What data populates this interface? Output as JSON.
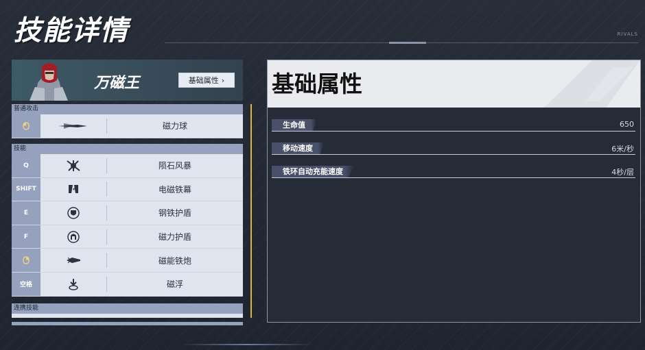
{
  "page": {
    "title": "技能详情",
    "brand": "RIVALS"
  },
  "hero": {
    "name": "万磁王",
    "basic_button_label": "基础属性",
    "basic_button_icon": "chevron-right-icon"
  },
  "sections": {
    "normal_attack": {
      "header": "普通攻击",
      "rows": [
        {
          "key": "🖱",
          "key_icon": "mouse-left-icon",
          "icon": "magnetic-projectile-icon",
          "label": "磁力球"
        }
      ]
    },
    "skills": {
      "header": "技能",
      "rows": [
        {
          "key": "Q",
          "icon": "meteor-storm-icon",
          "label": "陨石风暴"
        },
        {
          "key": "SHIFT",
          "icon": "iron-curtain-icon",
          "label": "电磁铁幕"
        },
        {
          "key": "E",
          "icon": "shield-icon",
          "label": "钢铁护盾"
        },
        {
          "key": "F",
          "icon": "helmet-shield-icon",
          "label": "磁力护盾"
        },
        {
          "key": "🖱",
          "key_icon": "mouse-right-icon",
          "icon": "cannon-icon",
          "label": "磁能铁炮"
        },
        {
          "key": "空格",
          "icon": "levitate-icon",
          "label": "磁浮"
        }
      ]
    },
    "team_up": {
      "header": "连携技能"
    }
  },
  "detail": {
    "title": "基础属性",
    "stats": [
      {
        "name": "生命值",
        "value": "650"
      },
      {
        "name": "移动速度",
        "value": "6米/秒"
      },
      {
        "name": "铁环自动充能速度",
        "value": "4秒/层"
      }
    ]
  },
  "colors": {
    "accent_scroll": "#e2b53c",
    "key_column": "#95a1bd",
    "row_background": "#dfe5ee"
  }
}
